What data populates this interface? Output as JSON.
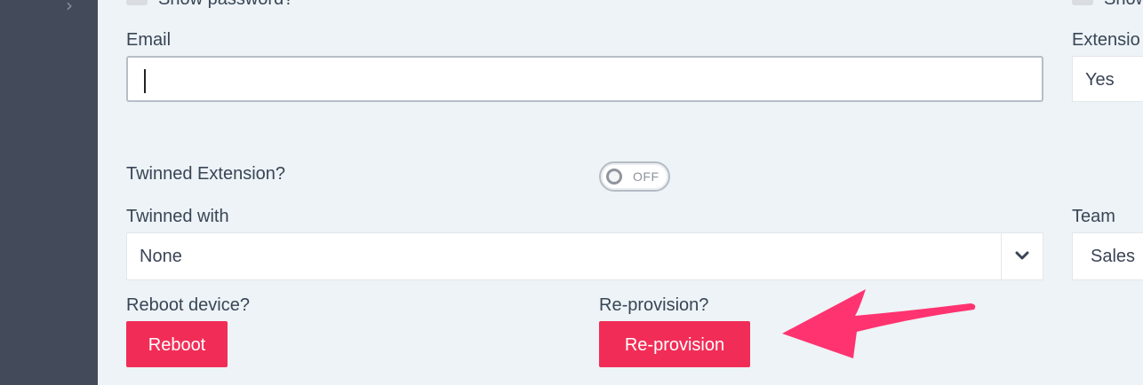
{
  "sidebar": {
    "expand_icon": "chevron-right-icon"
  },
  "form": {
    "top_checkbox_left_label": "Show password?",
    "top_checkbox_right_label": "Show",
    "email": {
      "label": "Email",
      "value": "",
      "placeholder": ""
    },
    "extension": {
      "label": "Extensio",
      "value": "Yes"
    },
    "twinned_extension": {
      "label": "Twinned Extension?",
      "state": "OFF"
    },
    "twinned_with": {
      "label": "Twinned with",
      "value": "None"
    },
    "team": {
      "label": "Team",
      "value": "Sales"
    },
    "reboot": {
      "label": "Reboot device?",
      "button": "Reboot"
    },
    "reprovision": {
      "label": "Re-provision?",
      "button": "Re-provision"
    }
  },
  "colors": {
    "accent": "#f12d57",
    "sidebar": "#434a5a",
    "background": "#edf3f6"
  },
  "annotation": {
    "arrow_icon": "pink-arrow-pointing-left",
    "arrow_color": "#ff3370"
  }
}
